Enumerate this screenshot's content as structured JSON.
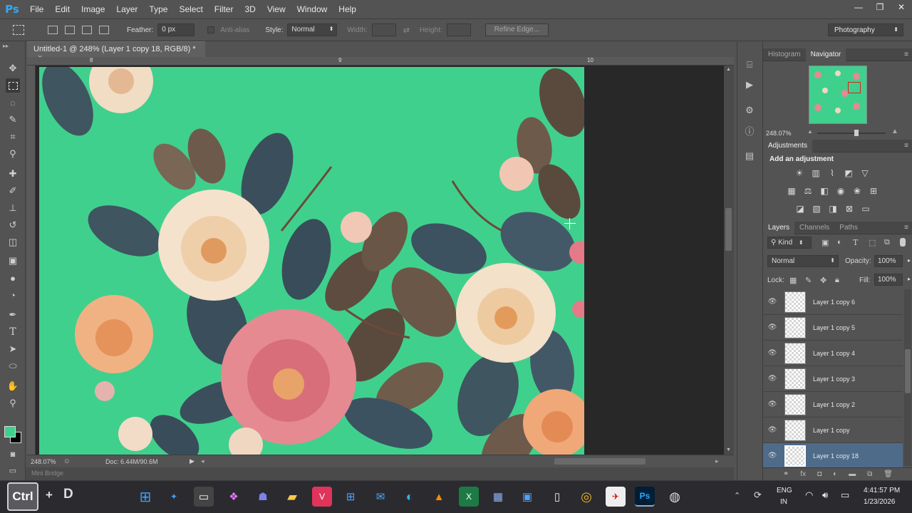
{
  "app": {
    "logo": "Ps"
  },
  "menubar": {
    "items": [
      "File",
      "Edit",
      "Image",
      "Layer",
      "Type",
      "Select",
      "Filter",
      "3D",
      "View",
      "Window",
      "Help"
    ]
  },
  "window_controls": {
    "minimize": "—",
    "restore": "❐",
    "close": "✕"
  },
  "options": {
    "feather_label": "Feather:",
    "feather_value": "0 px",
    "antialias_label": "Anti-alias",
    "style_label": "Style:",
    "style_value": "Normal",
    "width_label": "Width:",
    "height_label": "Height:",
    "refine_edge": "Refine Edge...",
    "workspace": "Photography"
  },
  "document": {
    "tab_title": "Untitled-1 @ 248% (Layer 1 copy 18, RGB/8) *",
    "close_glyph": "×",
    "ruler_labels": [
      "8",
      "9",
      "10"
    ],
    "zoom": "248.07%",
    "doc_size": "Doc: 6.44M/90.6M",
    "mini_bridge": "Mini Bridge",
    "canvas_color": "#40d08d"
  },
  "tools": [
    "move-tool-icon",
    "marquee-tool-icon",
    "lasso-tool-icon",
    "quick-select-tool-icon",
    "crop-tool-icon",
    "eyedropper-tool-icon",
    "healing-tool-icon",
    "brush-tool-icon",
    "stamp-tool-icon",
    "history-brush-icon",
    "eraser-tool-icon",
    "gradient-tool-icon",
    "blur-tool-icon",
    "dodge-tool-icon",
    "pen-tool-icon",
    "type-tool-icon",
    "path-select-icon",
    "shape-tool-icon",
    "hand-tool-icon",
    "zoom-tool-icon"
  ],
  "colors": {
    "foreground": "#40d08d",
    "background": "#000000"
  },
  "navigator": {
    "tabs": [
      "Histogram",
      "Navigator"
    ],
    "zoom": "248.07%"
  },
  "adjustments": {
    "tab": "Adjustments",
    "heading": "Add an adjustment"
  },
  "layers": {
    "tabs": [
      "Layers",
      "Channels",
      "Paths"
    ],
    "kind": "Kind",
    "blend_mode": "Normal",
    "opacity_label": "Opacity:",
    "opacity_value": "100%",
    "lock_label": "Lock:",
    "fill_label": "Fill:",
    "fill_value": "100%",
    "items": [
      {
        "name": "Layer 1 copy 6",
        "selected": false
      },
      {
        "name": "Layer 1 copy 5",
        "selected": false
      },
      {
        "name": "Layer 1 copy 4",
        "selected": false
      },
      {
        "name": "Layer 1 copy 3",
        "selected": false
      },
      {
        "name": "Layer 1 copy 2",
        "selected": false
      },
      {
        "name": "Layer 1 copy",
        "selected": false
      },
      {
        "name": "Layer 1 copy 18",
        "selected": true
      }
    ]
  },
  "taskbar": {
    "overlay_left": "Ctrl",
    "overlay_plus": "+",
    "overlay_key": "D",
    "lang_top": "ENG",
    "lang_bottom": "IN",
    "time": "4:41:57 PM",
    "date": "1/23/2026"
  }
}
